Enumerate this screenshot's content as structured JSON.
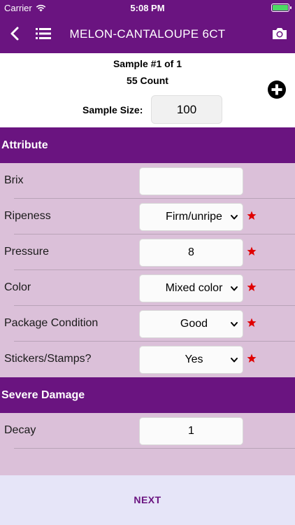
{
  "status_bar": {
    "carrier": "Carrier",
    "time": "5:08 PM",
    "battery_color": "#4cd964"
  },
  "nav": {
    "title": "MELON-CANTALOUPE 6CT",
    "back_icon": "chevron-left-icon",
    "list_icon": "list-icon",
    "camera_icon": "camera-icon"
  },
  "sample": {
    "title": "Sample #1 of 1",
    "count": "55 Count",
    "size_label": "Sample Size:",
    "size_value": "100",
    "add_icon": "plus-circle-icon"
  },
  "sections": {
    "attribute": "Attribute",
    "severe_damage": "Severe Damage"
  },
  "attributes": [
    {
      "label": "Brix",
      "value": "",
      "type": "input",
      "required": false
    },
    {
      "label": "Ripeness",
      "value": "Firm/unripe",
      "type": "select",
      "required": true
    },
    {
      "label": "Pressure",
      "value": "8",
      "type": "input",
      "required": true
    },
    {
      "label": "Color",
      "value": "Mixed color",
      "type": "select",
      "required": true
    },
    {
      "label": "Package Condition",
      "value": "Good",
      "type": "select",
      "required": true
    },
    {
      "label": "Stickers/Stamps?",
      "value": "Yes",
      "type": "select",
      "required": true
    }
  ],
  "severe_damage": [
    {
      "label": "Decay",
      "value": "1",
      "type": "input",
      "required": false
    }
  ],
  "footer": {
    "next_label": "NEXT"
  },
  "colors": {
    "brand_purple": "#6a1480",
    "row_background": "#dbc0d9",
    "required_star": "#e00000",
    "footer_background": "#e6e5f8"
  }
}
